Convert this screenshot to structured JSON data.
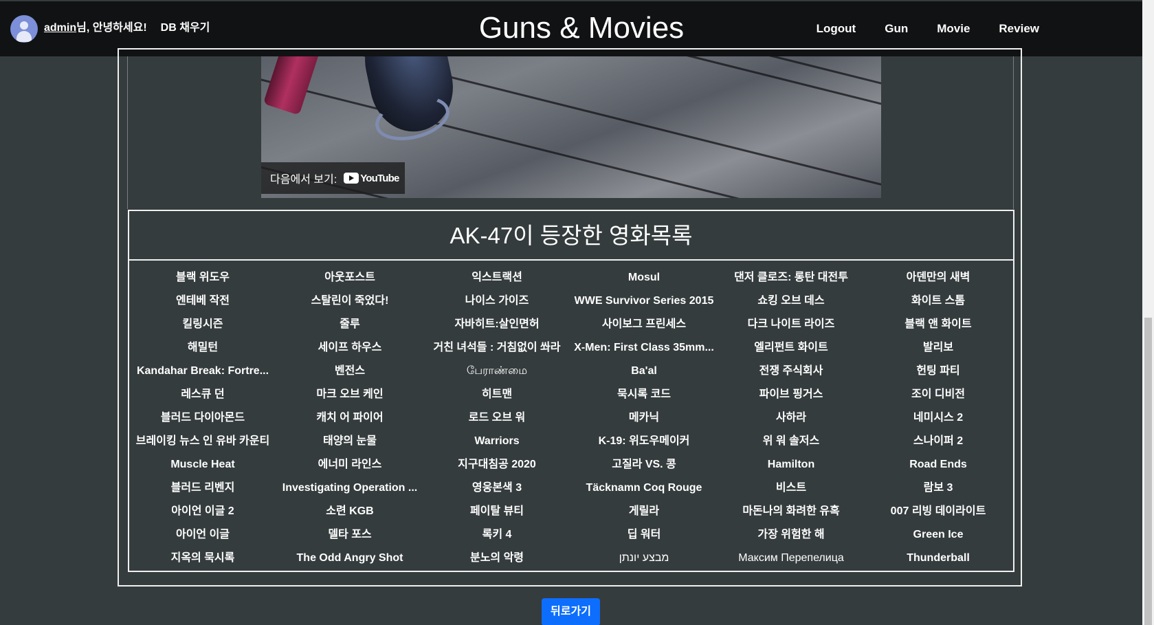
{
  "header": {
    "username": "admin",
    "greeting_suffix": "님, 안녕하세요!",
    "db_fill_label": "DB 채우기",
    "brand": "Guns & Movies",
    "nav_links": [
      "Logout",
      "Gun",
      "Movie",
      "Review"
    ]
  },
  "video": {
    "watch_on_label": "다음에서 보기:",
    "platform_label": "YouTube"
  },
  "movie_list": {
    "title": "AK-47이 등장한 영화목록",
    "movies": [
      "블랙 위도우",
      "아웃포스트",
      "익스트랙션",
      "Mosul",
      "댄저 클로즈: 롱탄 대전투",
      "아덴만의 새벽",
      "엔테베 작전",
      "스탈린이 죽었다!",
      "나이스 가이즈",
      "WWE Survivor Series 2015",
      "쇼킹 오브 데스",
      "화이트 스톰",
      "킬링시즌",
      "줄루",
      "자바히트:살인면허",
      "사이보그 프린세스",
      "다크 나이트 라이즈",
      "블랙 앤 화이트",
      "해밀턴",
      "세이프 하우스",
      "거친 녀석들 : 거침없이 쏴라",
      "X-Men: First Class 35mm...",
      "엘리펀트 화이트",
      "발리보",
      "Kandahar Break: Fortre...",
      "벤전스",
      "பேராண்மை",
      "Ba'al",
      "전쟁 주식회사",
      "헌팅 파티",
      "레스큐 던",
      "마크 오브 케인",
      "히트맨",
      "묵시록 코드",
      "파이브 핑거스",
      "조이 디비전",
      "블러드 다이아몬드",
      "캐치 어 파이어",
      "로드 오브 워",
      "메카닉",
      "사하라",
      "네미시스 2",
      "브레이킹 뉴스 인 유바 카운티",
      "태양의 눈물",
      "Warriors",
      "K-19: 위도우메이커",
      "위 워 솔저스",
      "스나이퍼 2",
      "Muscle Heat",
      "에너미 라인스",
      "지구대침공 2020",
      "고질라 VS. 콩",
      "Hamilton",
      "Road Ends",
      "블러드 리벤지",
      "Investigating Operation ...",
      "영웅본색 3",
      "Täcknamn Coq Rouge",
      "비스트",
      "람보 3",
      "아이언 이글 2",
      "소련 KGB",
      "페이탈 뷰티",
      "게릴라",
      "마돈나의 화려한 유혹",
      "007 리빙 데이라이트",
      "아이언 이글",
      "델타 포스",
      "록키 4",
      "딥 워터",
      "가장 위험한 해",
      "Green Ice",
      "지옥의 묵시록",
      "The Odd Angry Shot",
      "분노의 악령",
      "מבצע יונתן",
      "Максим Перепелица",
      "Thunderball"
    ]
  },
  "back_button_label": "뒤로가기",
  "colors": {
    "page_bg": "#353c3d",
    "navbar_bg": "#111214",
    "button_primary": "#0d6efd",
    "avatar": "#7c8fd8"
  }
}
